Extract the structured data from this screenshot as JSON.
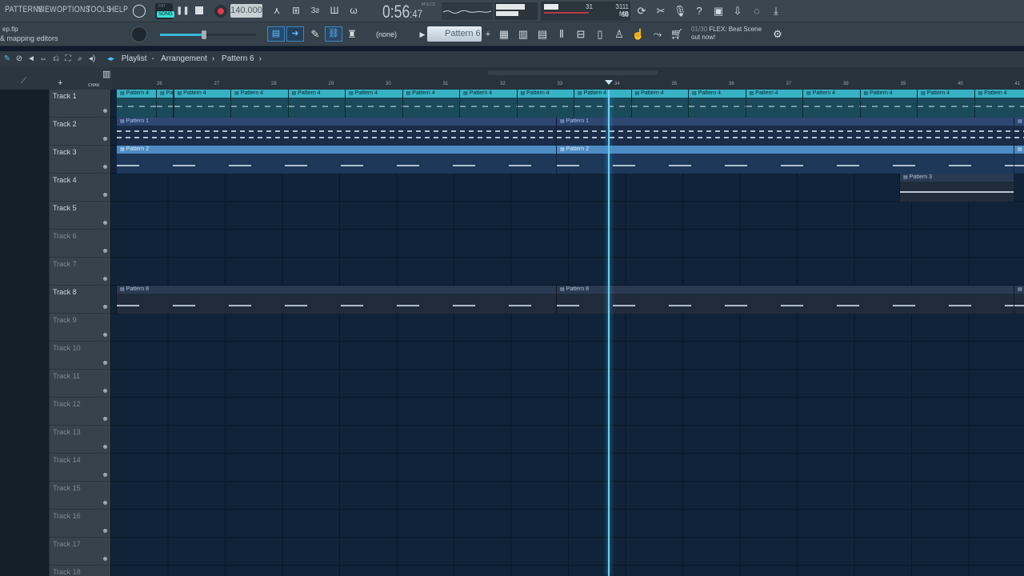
{
  "menu": [
    "PATTERNS",
    "VIEW",
    "OPTIONS",
    "TOOLS",
    "HELP"
  ],
  "transport": {
    "mode": "SONG",
    "pat_label": "PAT",
    "tempo": "140.000",
    "time": "0:56",
    "time_sub": "47",
    "time_unit": "M:S:CS"
  },
  "cpu": {
    "value": "31",
    "memory": "3111 MB",
    "polyphony": "59"
  },
  "hint": {
    "line1": "ep.flp",
    "line2": "& mapping editors"
  },
  "snap": {
    "label": "(none)"
  },
  "pattern_selector": {
    "value": "Pattern 6"
  },
  "news": {
    "count": "01/30",
    "text1": "FLEX: Beat Scene",
    "text2": "out now!"
  },
  "breadcrumb": {
    "first": "Playlist",
    "second": "Arrangement",
    "third": "Pattern 6"
  },
  "ruler": {
    "bars": [
      "26",
      "27",
      "28",
      "29",
      "30",
      "31",
      "32",
      "33",
      "34",
      "35",
      "36",
      "37",
      "38",
      "39",
      "40",
      "41"
    ]
  },
  "header_labels": {
    "plus": "+",
    "chan": "CHAN"
  },
  "tracks": [
    {
      "name": "Track 1",
      "dim": false
    },
    {
      "name": "Track 2",
      "dim": false
    },
    {
      "name": "Track 3",
      "dim": false
    },
    {
      "name": "Track 4",
      "dim": false
    },
    {
      "name": "Track 5",
      "dim": false
    },
    {
      "name": "Track 6",
      "dim": true
    },
    {
      "name": "Track 7",
      "dim": true
    },
    {
      "name": "Track 8",
      "dim": false
    },
    {
      "name": "Track 9",
      "dim": true
    },
    {
      "name": "Track 10",
      "dim": true
    },
    {
      "name": "Track 11",
      "dim": true
    },
    {
      "name": "Track 12",
      "dim": true
    },
    {
      "name": "Track 13",
      "dim": true
    },
    {
      "name": "Track 14",
      "dim": true
    },
    {
      "name": "Track 15",
      "dim": true
    },
    {
      "name": "Track 16",
      "dim": true
    },
    {
      "name": "Track 17",
      "dim": true
    },
    {
      "name": "Track 18",
      "dim": true
    }
  ],
  "clips": {
    "pattern4": "Pattern 4",
    "pattern1": "Pattern 1",
    "pattern2": "Pattern 2",
    "pattern3": "Pattern 3",
    "pattern8": "Pattern 8"
  },
  "colors": {
    "accent": "#37b2c4",
    "playhead": "#6ad0f2",
    "record": "#e2384a",
    "grid": "#102338"
  }
}
